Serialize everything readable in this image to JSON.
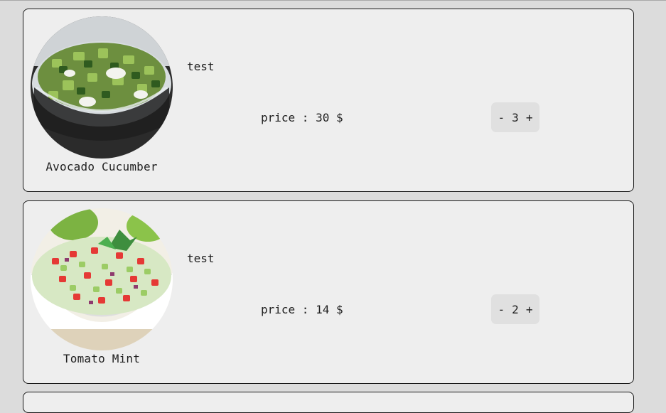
{
  "products": [
    {
      "name": "Avocado Cucumber",
      "description": "test",
      "price_text": "price : 30 $",
      "quantity": "3",
      "decrement_label": "-",
      "increment_label": "+",
      "image": "avocado-cucumber-salad-photo"
    },
    {
      "name": "Tomato Mint",
      "description": "test",
      "price_text": "price : 14 $",
      "quantity": "2",
      "decrement_label": "-",
      "increment_label": "+",
      "image": "tomato-mint-salad-photo"
    }
  ],
  "colors": {
    "background": "#dcdcdc",
    "card": "#eeeeee",
    "card_border": "#1a1a1a",
    "stepper": "#e0e0e0",
    "text": "#1f1f1f"
  }
}
